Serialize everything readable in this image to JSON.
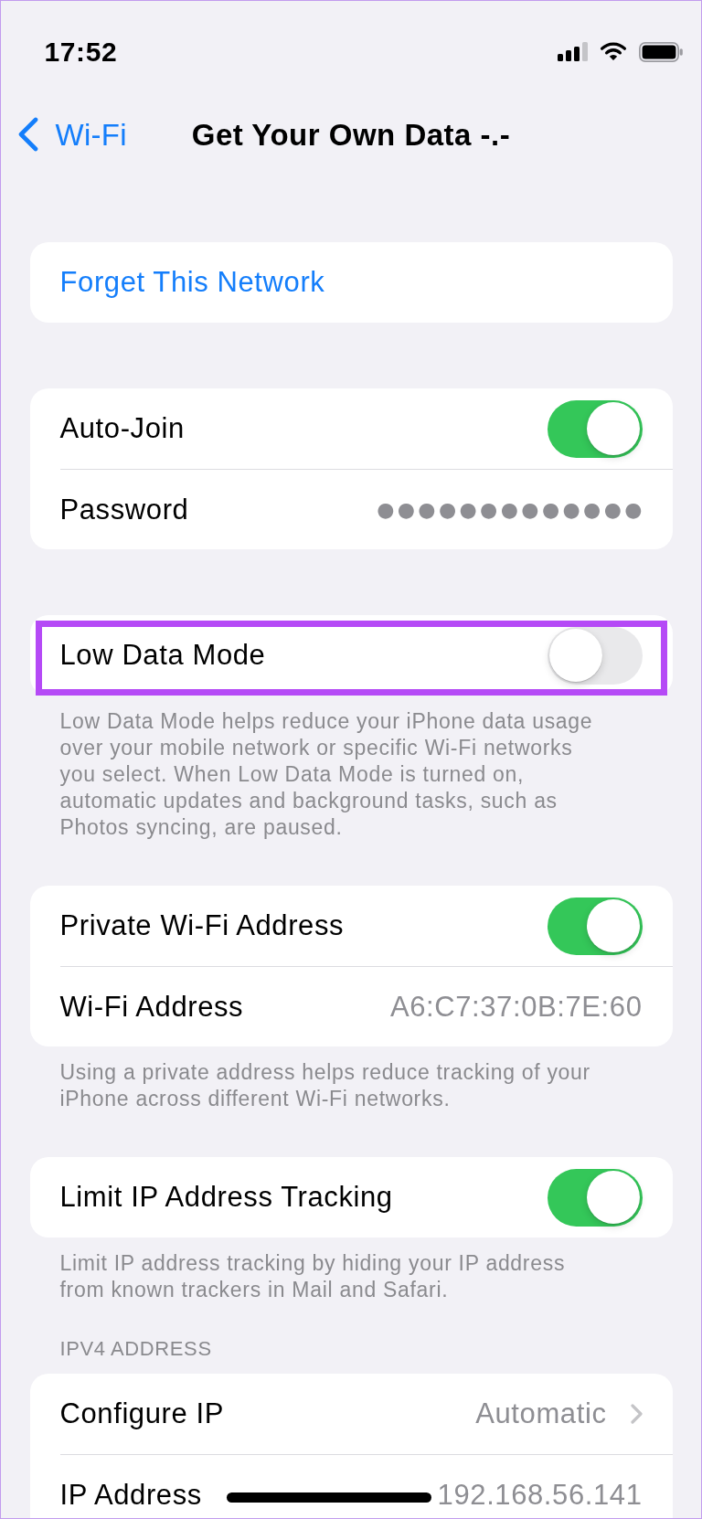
{
  "status_bar": {
    "time": "17:52"
  },
  "nav": {
    "back_label": "Wi-Fi",
    "title": "Get Your Own Data -.-"
  },
  "groups": [
    {
      "rows": [
        {
          "kind": "action",
          "label": "Forget This Network"
        }
      ]
    },
    {
      "rows": [
        {
          "kind": "toggle",
          "label": "Auto-Join",
          "on": true
        },
        {
          "kind": "secure",
          "label": "Password",
          "value": "●●●●●●●●●●●●●"
        }
      ]
    },
    {
      "highlighted": true,
      "rows": [
        {
          "kind": "toggle",
          "label": "Low Data Mode",
          "on": false
        }
      ],
      "footer": "Low Data Mode helps reduce your iPhone data usage over your mobile network or specific Wi-Fi networks you select. When Low Data Mode is turned on, automatic updates and background tasks, such as Photos syncing, are paused."
    },
    {
      "rows": [
        {
          "kind": "toggle",
          "label": "Private Wi-Fi Address",
          "on": true
        },
        {
          "kind": "value",
          "label": "Wi-Fi Address",
          "value": "A6:C7:37:0B:7E:60"
        }
      ],
      "footer": "Using a private address helps reduce tracking of your iPhone across different Wi-Fi networks."
    },
    {
      "rows": [
        {
          "kind": "toggle",
          "label": "Limit IP Address Tracking",
          "on": true
        }
      ],
      "footer": "Limit IP address tracking by hiding your IP address from known trackers in Mail and Safari."
    },
    {
      "header": "IPV4 ADDRESS",
      "rows": [
        {
          "kind": "link",
          "label": "Configure IP",
          "value": "Automatic"
        },
        {
          "kind": "value",
          "label": "IP Address",
          "value": "192.168.56.141"
        }
      ]
    }
  ]
}
